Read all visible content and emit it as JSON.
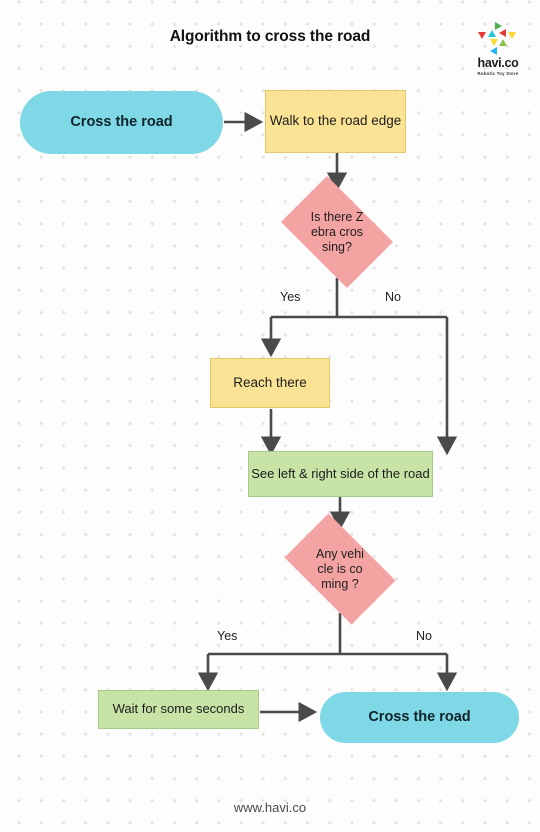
{
  "header": {
    "title": "Algorithm to cross the road",
    "logo": {
      "wordmark": "havi.co",
      "tagline": "Robotic Toy Store"
    }
  },
  "footer": {
    "url": "www.havi.co"
  },
  "colors": {
    "terminator": "#7ed8e6",
    "process_yellow": "#fbe395",
    "process_green": "#c7e3a6",
    "decision_pink": "#f4a3a3",
    "connector": "#4a4a4a",
    "background": "#fdfdfd",
    "dot_grid": "#e3e3e3"
  },
  "flowchart": {
    "nodes": [
      {
        "id": "start",
        "type": "terminator",
        "label": "Cross the road"
      },
      {
        "id": "walk",
        "type": "process",
        "label": "Walk to the road edge"
      },
      {
        "id": "zebra",
        "type": "decision",
        "label": "Is there Zebra crossing?"
      },
      {
        "id": "reach",
        "type": "process",
        "label": "Reach there"
      },
      {
        "id": "look",
        "type": "process",
        "label": "See left & right side of the road"
      },
      {
        "id": "vehicle",
        "type": "decision",
        "label": "Any vehicle is coming ?"
      },
      {
        "id": "wait",
        "type": "process",
        "label": "Wait for some seconds"
      },
      {
        "id": "end",
        "type": "terminator",
        "label": "Cross the road"
      }
    ],
    "edge_labels": {
      "zebra_yes": "Yes",
      "zebra_no": "No",
      "vehicle_yes": "Yes",
      "vehicle_no": "No"
    }
  }
}
